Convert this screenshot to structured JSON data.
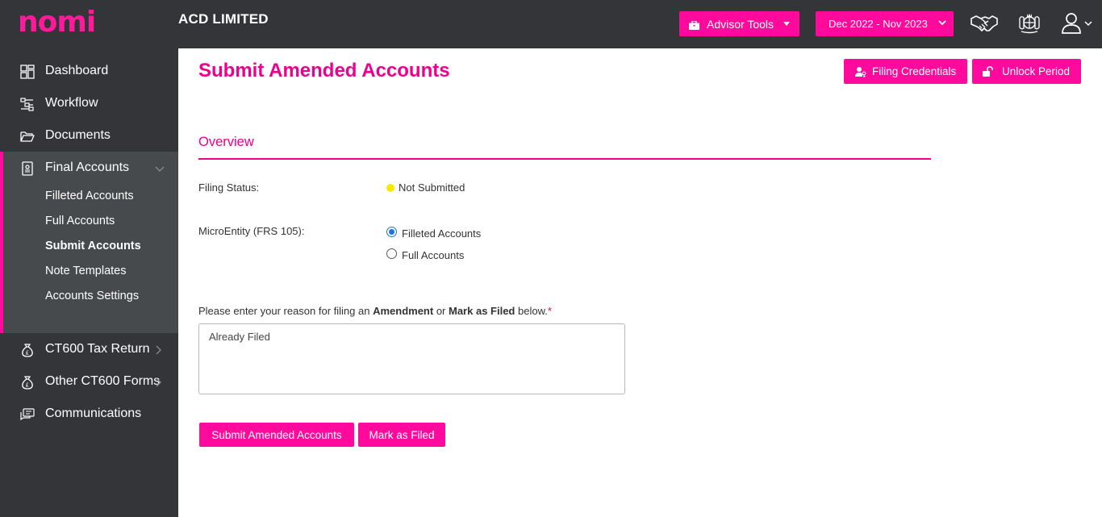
{
  "app": {
    "logo": "nomi",
    "company": "ACD LIMITED"
  },
  "header": {
    "advisor_tools": "Advisor Tools",
    "period": "Dec 2022 - Nov 2023",
    "icons": [
      "briefcase-icon",
      "handshake-icon",
      "royal-crest-icon",
      "user-icon"
    ]
  },
  "sidebar": {
    "items": [
      {
        "label": "Dashboard",
        "icon": "dashboard-icon"
      },
      {
        "label": "Workflow",
        "icon": "workflow-icon"
      },
      {
        "label": "Documents",
        "icon": "folder-icon"
      },
      {
        "label": "Final Accounts",
        "icon": "accounts-icon"
      },
      {
        "label": "CT600 Tax Return",
        "icon": "money-bag-icon"
      },
      {
        "label": "Other CT600 Forms",
        "icon": "money-bag-icon"
      },
      {
        "label": "Communications",
        "icon": "chat-icon"
      }
    ],
    "final_accounts_sub": [
      {
        "label": "Filleted Accounts"
      },
      {
        "label": "Full Accounts"
      },
      {
        "label": "Submit Accounts",
        "active": true
      },
      {
        "label": "Note Templates"
      },
      {
        "label": "Accounts Settings"
      }
    ]
  },
  "main": {
    "title": "Submit Amended Accounts",
    "filing_credentials": "Filing Credentials",
    "unlock_period": "Unlock Period",
    "overview": "Overview",
    "filing_status_label": "Filing Status:",
    "filing_status_value": "Not Submitted",
    "micro_label": "MicroEntity (FRS 105):",
    "radio_options": [
      {
        "label": "Filleted Accounts",
        "checked": true
      },
      {
        "label": "Full Accounts",
        "checked": false
      }
    ],
    "reason_prefix": "Please enter your reason for filing an ",
    "reason_amendment": "Amendment",
    "reason_or": " or ",
    "reason_mark": "Mark as Filed",
    "reason_suffix": " below.",
    "reason_required": "*",
    "reason_value": "Already Filed",
    "submit_button": "Submit Amended Accounts",
    "mark_button": "Mark as Filed"
  },
  "colors": {
    "accent": "#ff0a9c",
    "title": "#ec008c",
    "sidebar": "#333538",
    "sidebar_group": "#474a4d",
    "status_dot": "#f5ea00"
  }
}
